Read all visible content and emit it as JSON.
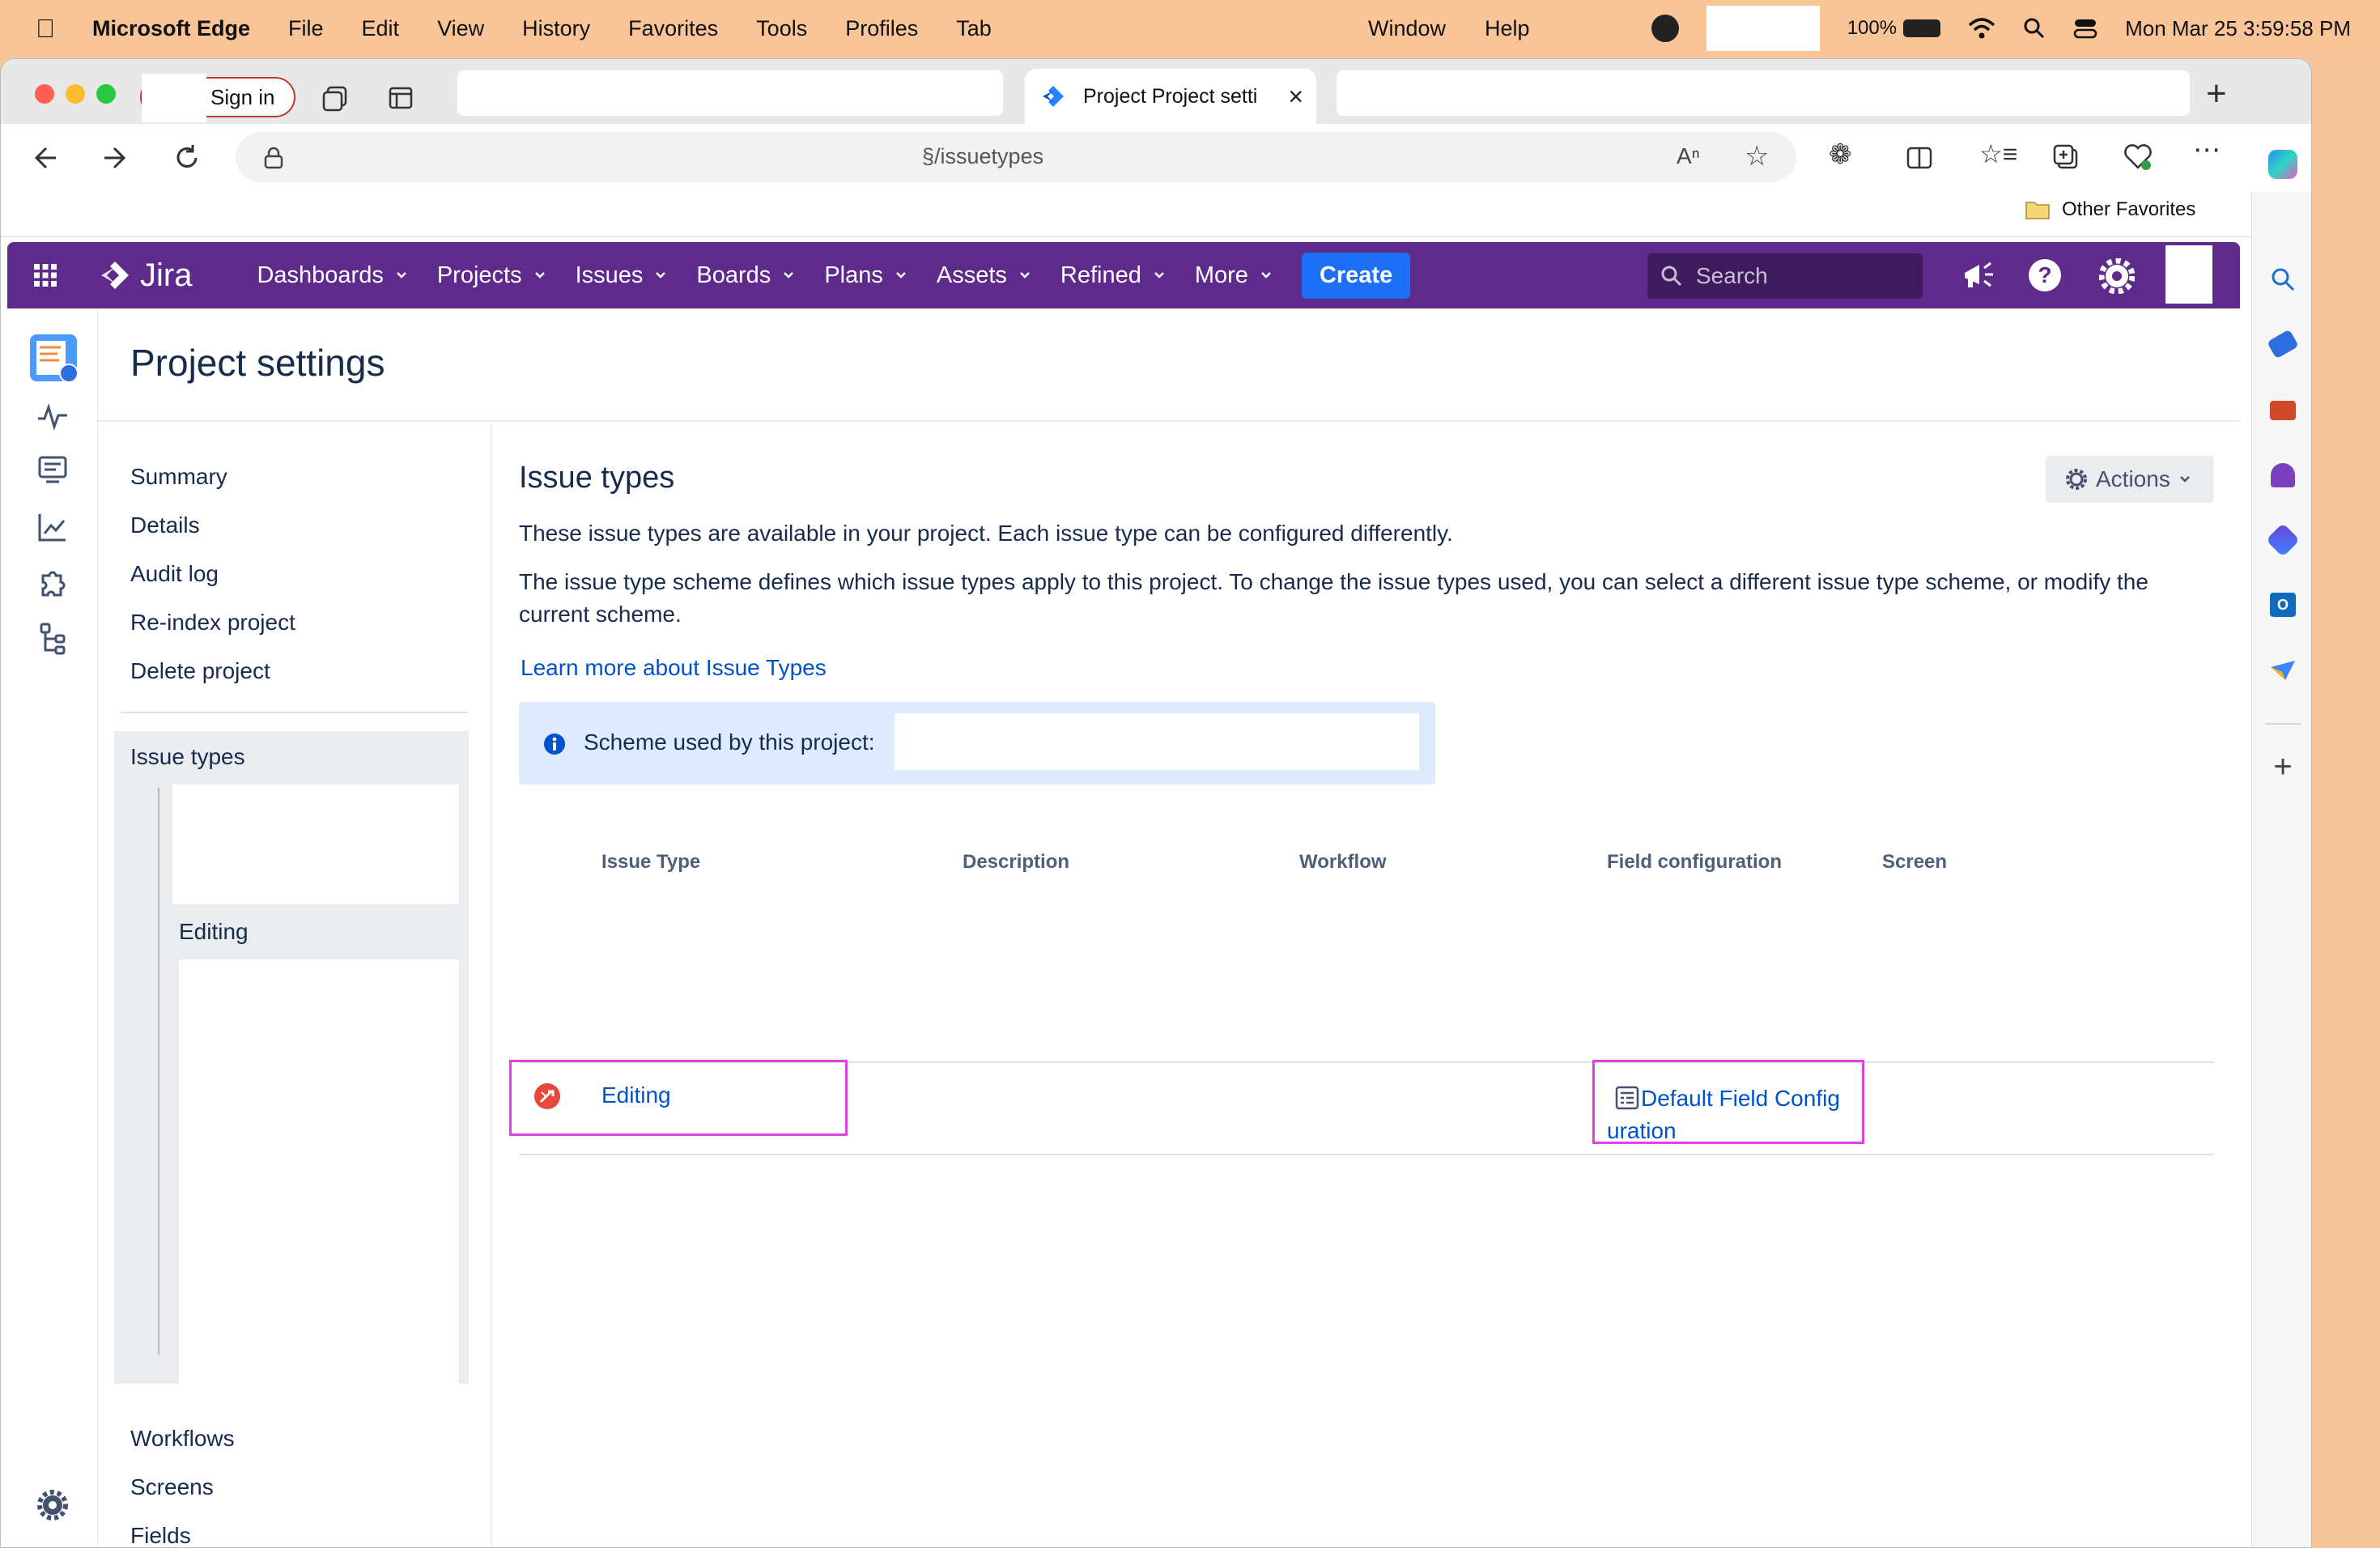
{
  "menubar": {
    "app": "Microsoft Edge",
    "items": [
      "File",
      "Edit",
      "View",
      "History",
      "Favorites",
      "Tools",
      "Profiles",
      "Tab"
    ],
    "window": "Window",
    "help": "Help",
    "battery": "100%",
    "clock": "Mon Mar 25  3:59:58 PM"
  },
  "browser": {
    "sign_in": "Sign in",
    "active_tab_title": "Project Project setti",
    "address": "§/issuetypes",
    "other_favorites": "Other Favorites"
  },
  "jira": {
    "logo": "Jira",
    "nav": [
      "Dashboards",
      "Projects",
      "Issues",
      "Boards",
      "Plans",
      "Assets",
      "Refined",
      "More"
    ],
    "create": "Create",
    "search_placeholder": "Search",
    "page_title": "Project settings",
    "sidebar": {
      "items": [
        "Summary",
        "Details",
        "Audit log",
        "Re-index project",
        "Delete project"
      ],
      "issue_types": "Issue types",
      "issue_types_child": "Editing",
      "bottom_items": [
        "Workflows",
        "Screens",
        "Fields"
      ]
    },
    "content": {
      "heading": "Issue types",
      "actions": "Actions",
      "para1": "These issue types are available in your project. Each issue type can be configured differently.",
      "para2": "The issue type scheme defines which issue types apply to this project. To change the issue types used, you can select a different issue type scheme, or modify the current scheme.",
      "learn_more": "Learn more about Issue Types",
      "scheme_label": "Scheme used by this project:",
      "table": {
        "headers": [
          "Issue Type",
          "Description",
          "Workflow",
          "Field configuration",
          "Screen"
        ],
        "rows": [
          {
            "issue_type": "Editing",
            "field_config_line1": "Default Field Config",
            "field_config_line2": "uration"
          }
        ]
      }
    }
  }
}
